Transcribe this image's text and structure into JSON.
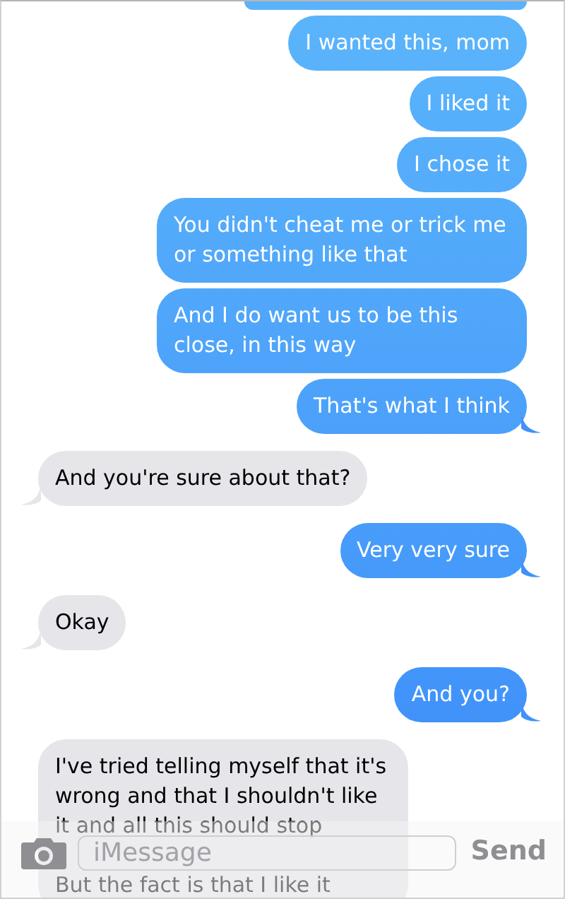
{
  "messages": [
    {
      "kind": "sent",
      "text": "I wanted this, mom",
      "tail": false
    },
    {
      "kind": "sent",
      "text": "I liked it",
      "tail": false
    },
    {
      "kind": "sent",
      "text": "I chose it",
      "tail": false
    },
    {
      "kind": "sent",
      "text": "You didn't cheat me or trick me or something like that",
      "tail": false
    },
    {
      "kind": "sent",
      "text": "And I do want us to be this close, in this way",
      "tail": false
    },
    {
      "kind": "sent",
      "text": "That's what I think",
      "tail": true
    },
    {
      "kind": "received",
      "text": "And you're sure about that?",
      "tail": true
    },
    {
      "kind": "sent",
      "text": "Very very sure",
      "tail": true
    },
    {
      "kind": "received",
      "text": "Okay",
      "tail": true
    },
    {
      "kind": "sent",
      "text": "And you?",
      "tail": true
    },
    {
      "kind": "received",
      "text": "I've tried telling myself that it's wrong and that I shouldn't like it and all this should stop\n\nBut the fact is that I like it",
      "tail": false
    }
  ],
  "composer": {
    "placeholder": "iMessage",
    "send": "Send"
  }
}
